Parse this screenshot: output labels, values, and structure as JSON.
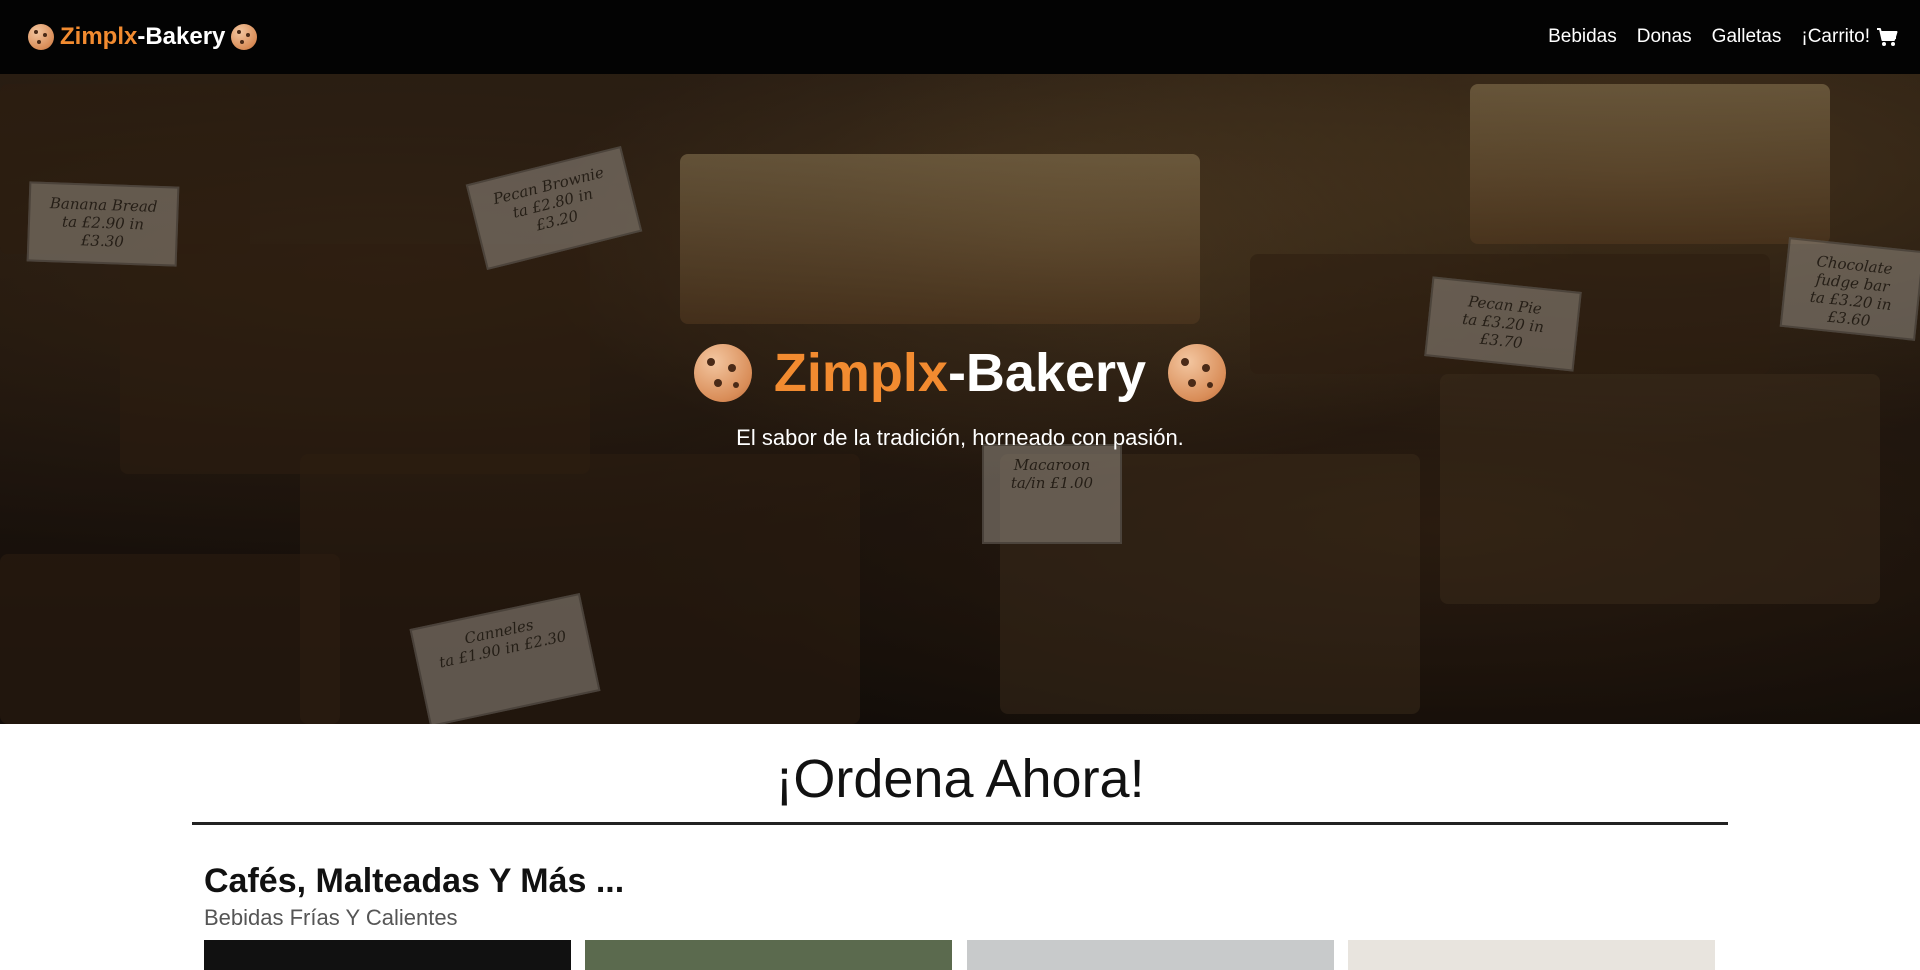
{
  "navbar": {
    "brand_accent": "Zimplx",
    "brand_rest": "-Bakery",
    "links": [
      "Bebidas",
      "Donas",
      "Galletas"
    ],
    "cart_label": "¡Carrito!"
  },
  "hero": {
    "title_accent": "Zimplx",
    "title_rest": "-Bakery",
    "subtitle": "El sabor de la tradición, horneado con pasión.",
    "price_cards": [
      {
        "name": "Banana Bread",
        "price": "ta £2.90   in £3.30"
      },
      {
        "name": "Pecan Brownie",
        "price": "ta £2.80   in £3.20"
      },
      {
        "name": "Pecan Pie",
        "price": "ta £3.20   in £3.70"
      },
      {
        "name": "Macaroon",
        "price": "ta/in £1.00"
      },
      {
        "name": "Canneles",
        "price": "ta £1.90   in £2.30"
      },
      {
        "name": "Chocolate fudge bar",
        "price": "ta £3.20   in £3.60"
      }
    ]
  },
  "order_section": {
    "title": "¡Ordena Ahora!",
    "category_title": "Cafés, Malteadas Y Más ...",
    "category_subtitle": "Bebidas Frías Y Calientes"
  },
  "colors": {
    "accent": "#f28b30",
    "navbar_bg": "#030303"
  },
  "icons": {
    "brand": "cookie-icon",
    "cart": "shopping-cart-icon"
  }
}
